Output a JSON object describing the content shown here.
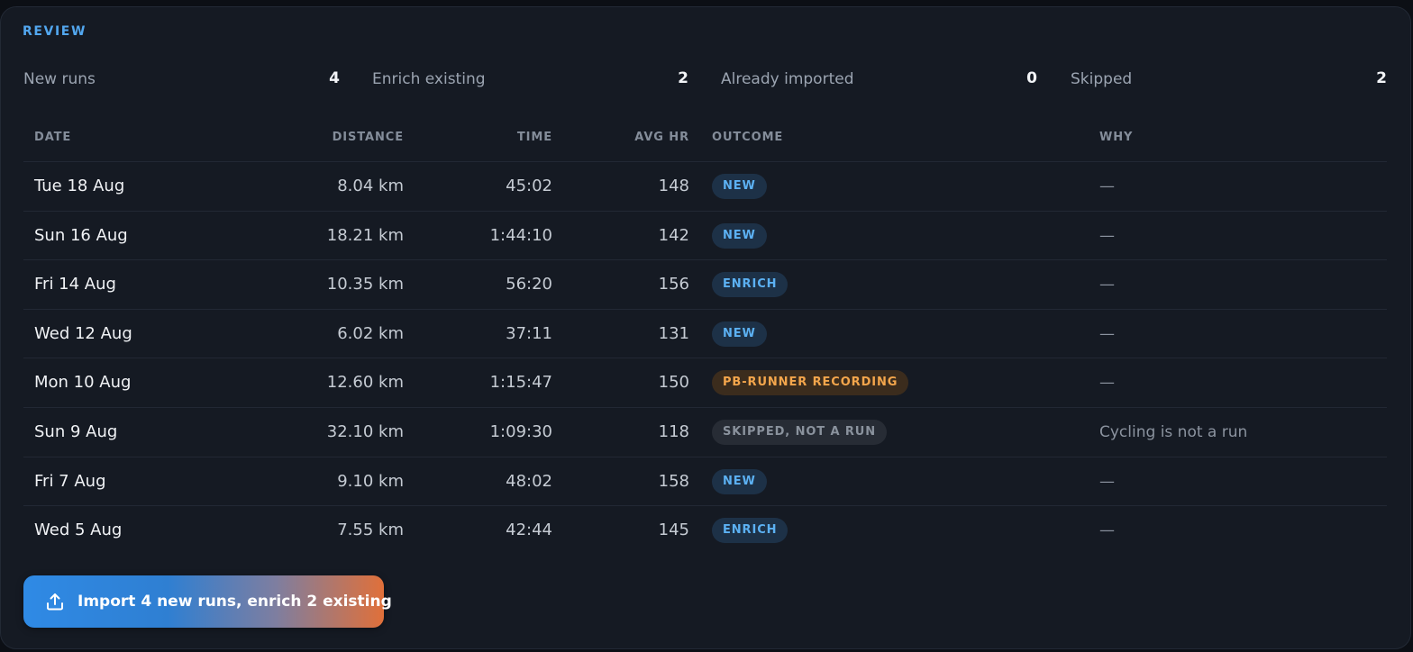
{
  "section_label": "REVIEW",
  "summary": [
    {
      "label": "New runs",
      "value": "4"
    },
    {
      "label": "Enrich existing",
      "value": "2"
    },
    {
      "label": "Already imported",
      "value": "0"
    },
    {
      "label": "Skipped",
      "value": "2"
    }
  ],
  "table": {
    "headers": {
      "date": "DATE",
      "distance": "DISTANCE",
      "time": "TIME",
      "avg_hr": "AVG HR",
      "outcome": "OUTCOME",
      "why": "WHY"
    },
    "rows": [
      {
        "date": "Tue 18 Aug",
        "distance": "8.04 km",
        "time": "45:02",
        "avg_hr": "148",
        "outcome": "NEW",
        "outcome_kind": "new",
        "why": "—"
      },
      {
        "date": "Sun 16 Aug",
        "distance": "18.21 km",
        "time": "1:44:10",
        "avg_hr": "142",
        "outcome": "NEW",
        "outcome_kind": "new",
        "why": "—"
      },
      {
        "date": "Fri 14 Aug",
        "distance": "10.35 km",
        "time": "56:20",
        "avg_hr": "156",
        "outcome": "ENRICH",
        "outcome_kind": "enrich",
        "why": "—"
      },
      {
        "date": "Wed 12 Aug",
        "distance": "6.02 km",
        "time": "37:11",
        "avg_hr": "131",
        "outcome": "NEW",
        "outcome_kind": "new",
        "why": "—"
      },
      {
        "date": "Mon 10 Aug",
        "distance": "12.60 km",
        "time": "1:15:47",
        "avg_hr": "150",
        "outcome": "PB-RUNNER RECORDING",
        "outcome_kind": "recording",
        "why": "—"
      },
      {
        "date": "Sun 9 Aug",
        "distance": "32.10 km",
        "time": "1:09:30",
        "avg_hr": "118",
        "outcome": "SKIPPED, NOT A RUN",
        "outcome_kind": "skipped",
        "why": "Cycling is not a run"
      },
      {
        "date": "Fri 7 Aug",
        "distance": "9.10 km",
        "time": "48:02",
        "avg_hr": "158",
        "outcome": "NEW",
        "outcome_kind": "new",
        "why": "—"
      },
      {
        "date": "Wed 5 Aug",
        "distance": "7.55 km",
        "time": "42:44",
        "avg_hr": "145",
        "outcome": "ENRICH",
        "outcome_kind": "enrich",
        "why": "—"
      }
    ]
  },
  "badge_colors": {
    "new": {
      "bg": "#1d3147",
      "fg": "#5cb1f3"
    },
    "enrich": {
      "bg": "#1d3147",
      "fg": "#5cb1f3"
    },
    "recording": {
      "bg": "#3b2c1d",
      "fg": "#f4a64c"
    },
    "skipped": {
      "bg": "#272c35",
      "fg": "#8a929d"
    }
  },
  "import_button": {
    "label": "Import 4 new runs, enrich 2 existing",
    "icon": "upload-icon"
  }
}
